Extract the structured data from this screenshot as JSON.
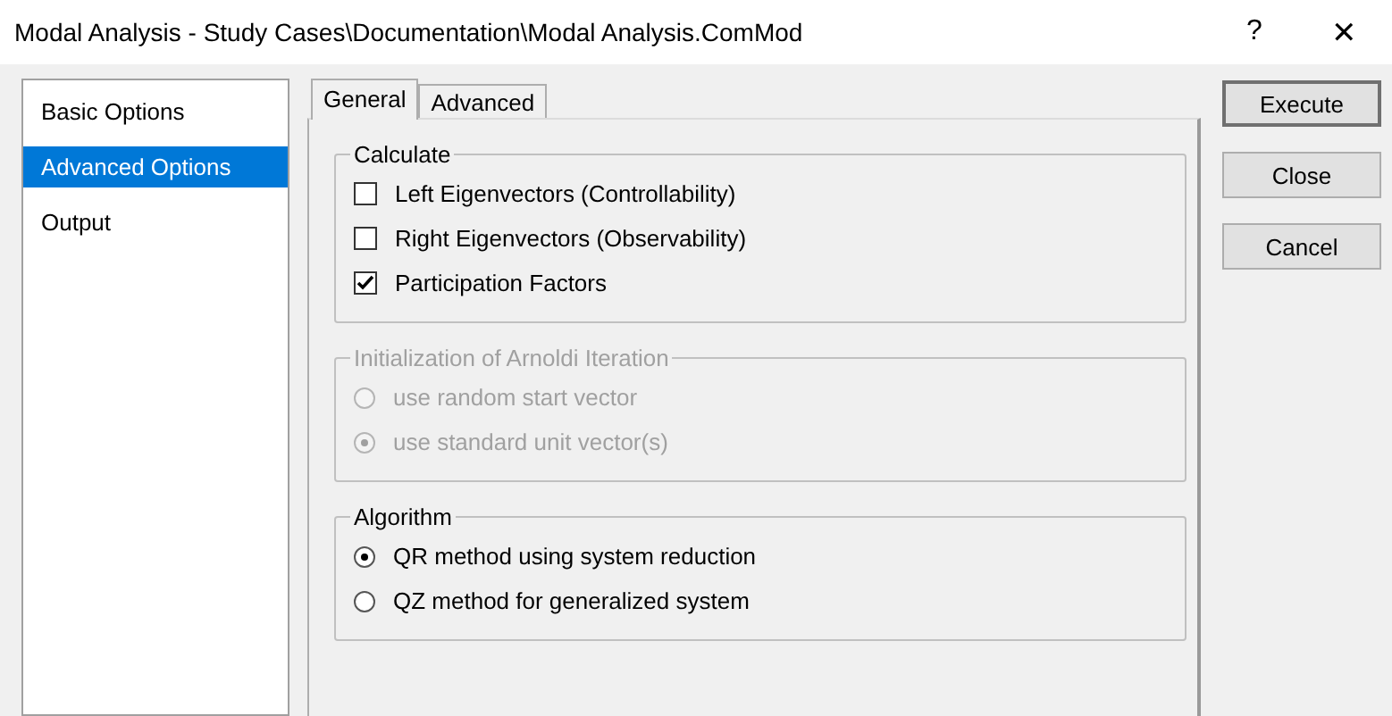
{
  "window": {
    "title": "Modal Analysis - Study Cases\\Documentation\\Modal Analysis.ComMod",
    "help": "?",
    "close": "✕"
  },
  "sidebar": {
    "items": [
      {
        "label": "Basic Options",
        "selected": false
      },
      {
        "label": "Advanced Options",
        "selected": true
      },
      {
        "label": "Output",
        "selected": false
      }
    ]
  },
  "tabs": [
    {
      "label": "General",
      "selected": true
    },
    {
      "label": "Advanced",
      "selected": false
    }
  ],
  "groups": [
    {
      "title": "Calculate",
      "kind": "checkbox",
      "disabled": false,
      "items": [
        {
          "label": "Left Eigenvectors (Controllability)",
          "checked": false
        },
        {
          "label": "Right Eigenvectors (Observability)",
          "checked": false
        },
        {
          "label": "Participation Factors",
          "checked": true
        }
      ]
    },
    {
      "title": "Initialization of Arnoldi Iteration",
      "kind": "radio",
      "disabled": true,
      "items": [
        {
          "label": "use random start vector",
          "selected": false
        },
        {
          "label": "use standard unit vector(s)",
          "selected": true
        }
      ]
    },
    {
      "title": "Algorithm",
      "kind": "radio",
      "disabled": false,
      "items": [
        {
          "label": "QR method using system reduction",
          "selected": true
        },
        {
          "label": "QZ method for generalized system",
          "selected": false
        }
      ]
    }
  ],
  "buttons": [
    {
      "label": "Execute",
      "default": true
    },
    {
      "label": "Close",
      "default": false
    },
    {
      "label": "Cancel",
      "default": false
    }
  ]
}
